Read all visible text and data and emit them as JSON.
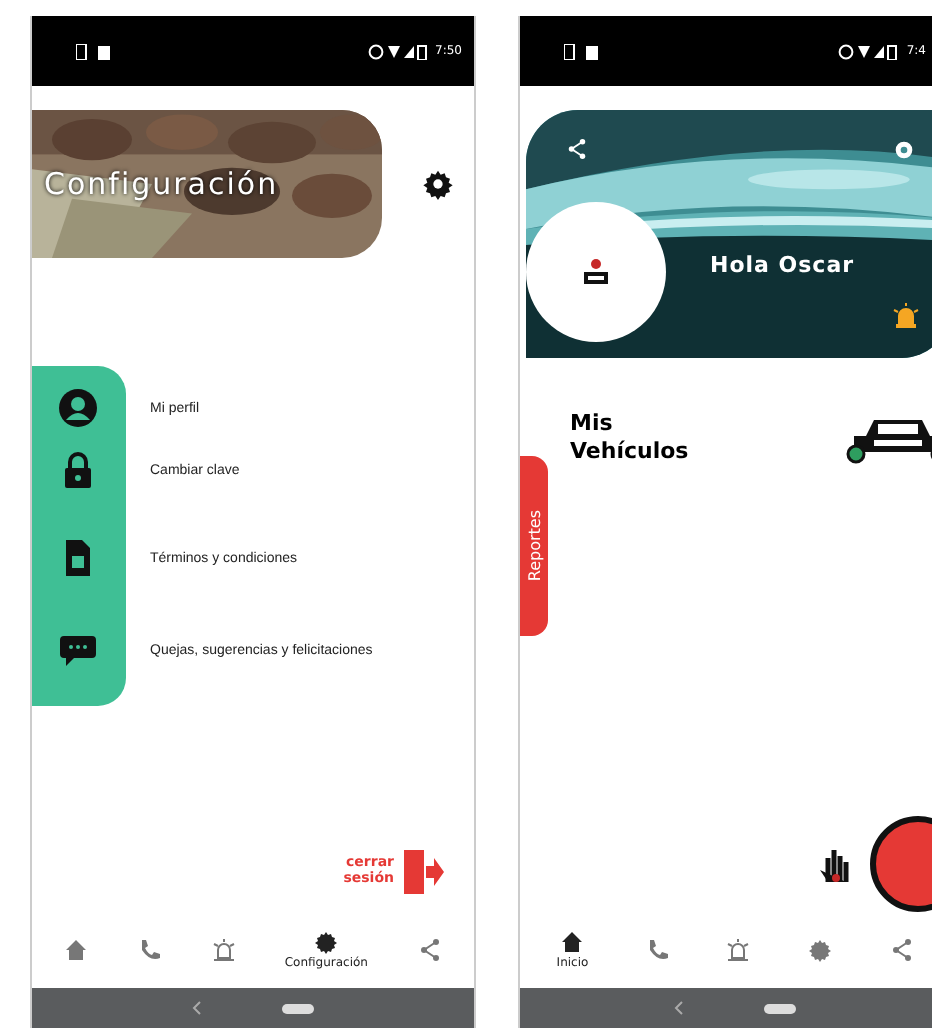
{
  "settings_screen": {
    "status_bar": {
      "time": "7:50"
    },
    "header": {
      "title": "Configuración"
    },
    "menu": [
      {
        "label": "Mi perfil",
        "kind": "profile"
      },
      {
        "label": "Cambiar clave",
        "kind": "lock"
      },
      {
        "label": "Términos y condiciones",
        "kind": "document"
      },
      {
        "label": "Quejas, sugerencias y felicitaciones",
        "kind": "chat"
      }
    ],
    "logout": {
      "label": "cerrar sesión"
    },
    "nav": [
      {
        "kind": "home",
        "selected": false
      },
      {
        "kind": "phone",
        "selected": false
      },
      {
        "kind": "alarm",
        "selected": false
      },
      {
        "kind": "settings",
        "selected": true,
        "label": "Configuración"
      },
      {
        "kind": "share",
        "selected": false
      }
    ]
  },
  "home_screen": {
    "status_bar": {
      "time": "7:4"
    },
    "header": {
      "greeting": "Hola Oscar"
    },
    "vehicles": {
      "title": "Mis Vehículos"
    },
    "side_tab": {
      "label": "Reportes"
    },
    "nav": [
      {
        "kind": "home",
        "selected": true,
        "label": "Inicio"
      },
      {
        "kind": "phone",
        "selected": false
      },
      {
        "kind": "alarm",
        "selected": false
      },
      {
        "kind": "settings",
        "selected": false
      },
      {
        "kind": "share",
        "selected": false
      }
    ]
  }
}
